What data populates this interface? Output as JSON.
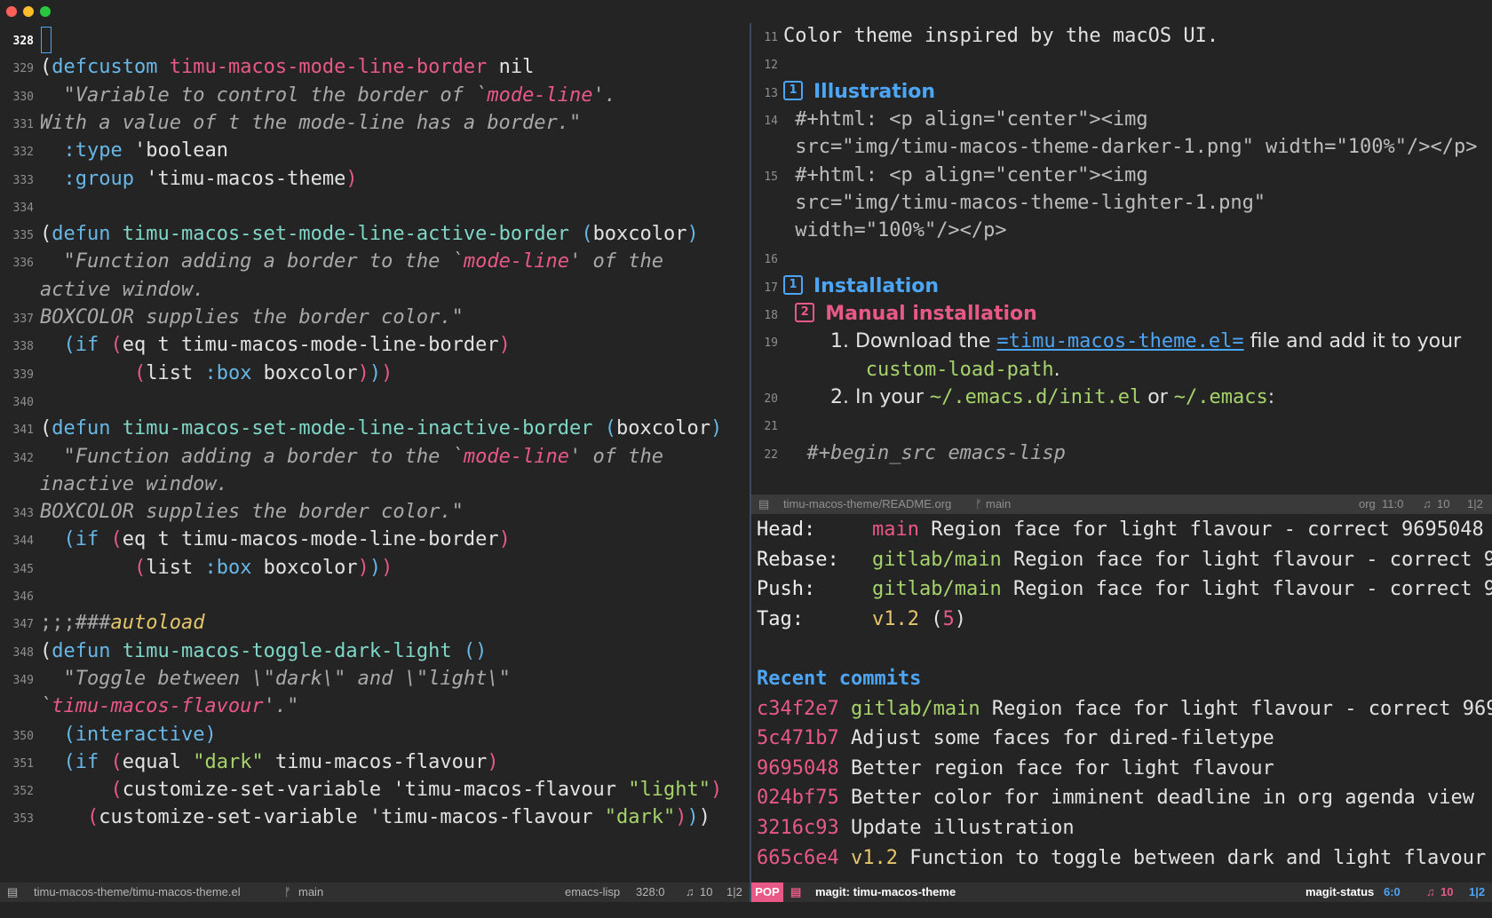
{
  "left_editor": {
    "lines": [
      {
        "num": "328",
        "current": true,
        "html": ""
      },
      {
        "num": "329",
        "html": "<span class=\"par1\">(</span><span class=\"kw\">defcustom</span> <span class=\"fn\">timu-macos-mode-line-border</span> nil"
      },
      {
        "num": "330",
        "html": "  <span class=\"str\">\"Variable to control the border of `</span><span class=\"strref\">mode-line</span><span class=\"str\">'.</span>"
      },
      {
        "num": "331",
        "html": "<span class=\"str\">With a value of t the mode-line has a border.\"</span>"
      },
      {
        "num": "332",
        "html": "  <span class=\"sym\">:type</span> 'boolean"
      },
      {
        "num": "333",
        "html": "  <span class=\"sym\">:group</span> 'timu-macos-theme<span class=\"par3\">)</span>"
      },
      {
        "num": "334",
        "html": ""
      },
      {
        "num": "335",
        "html": "<span class=\"par1\">(</span><span class=\"kw\">defun</span> <span class=\"fn2\">timu-macos-set-mode-line-active-border</span> <span class=\"par2\">(</span>boxcolor<span class=\"par2\">)</span>"
      },
      {
        "num": "336",
        "html": "  <span class=\"str\">\"Function adding a border to the `</span><span class=\"strref\">mode-line</span><span class=\"str\">' of the</span>"
      },
      {
        "num": null,
        "html": "<span class=\"str\">active window.</span>"
      },
      {
        "num": "337",
        "html": "<span class=\"str\">BOXCOLOR supplies the border color.\"</span>"
      },
      {
        "num": "338",
        "html": "  <span class=\"par2\">(</span><span class=\"kw\">if</span> <span class=\"par3\">(</span>eq t timu-macos-mode-line-border<span class=\"par3\">)</span>"
      },
      {
        "num": "339",
        "html": "        <span class=\"par3\">(</span>list <span class=\"sym\">:box</span> boxcolor<span class=\"par3\">)</span><span class=\"par2\">)</span><span class=\"par3\">)</span>"
      },
      {
        "num": "340",
        "html": ""
      },
      {
        "num": "341",
        "html": "<span class=\"par1\">(</span><span class=\"kw\">defun</span> <span class=\"fn2\">timu-macos-set-mode-line-inactive-border</span> <span class=\"par2\">(</span>boxcolor<span class=\"par2\">)</span>"
      },
      {
        "num": "342",
        "html": "  <span class=\"str\">\"Function adding a border to the `</span><span class=\"strref\">mode-line</span><span class=\"str\">' of the</span>"
      },
      {
        "num": null,
        "html": "<span class=\"str\">inactive window.</span>"
      },
      {
        "num": "343",
        "html": "<span class=\"str\">BOXCOLOR supplies the border color.\"</span>"
      },
      {
        "num": "344",
        "html": "  <span class=\"par2\">(</span><span class=\"kw\">if</span> <span class=\"par3\">(</span>eq t timu-macos-mode-line-border<span class=\"par3\">)</span>"
      },
      {
        "num": "345",
        "html": "        <span class=\"par3\">(</span>list <span class=\"sym\">:box</span> boxcolor<span class=\"par3\">)</span><span class=\"par2\">)</span><span class=\"par3\">)</span>"
      },
      {
        "num": "346",
        "html": ""
      },
      {
        "num": "347",
        "html": "<span class=\"comment\">;;;###</span><span class=\"autoload\">autoload</span>"
      },
      {
        "num": "348",
        "html": "<span class=\"par1\">(</span><span class=\"kw\">defun</span> <span class=\"fn2\">timu-macos-toggle-dark-light</span> <span class=\"par2\">()</span>"
      },
      {
        "num": "349",
        "html": "  <span class=\"str\">\"Toggle between \\\"dark\\\" and \\\"light\\\"</span>"
      },
      {
        "num": null,
        "html": "<span class=\"str\">`</span><span class=\"strref\">timu-macos-flavour</span><span class=\"str\">'.\"</span>"
      },
      {
        "num": "350",
        "html": "  <span class=\"par2\">(</span><span class=\"kw\">interactive</span><span class=\"par2\">)</span>"
      },
      {
        "num": "351",
        "html": "  <span class=\"par2\">(</span><span class=\"kw\">if</span> <span class=\"par3\">(</span>equal <span class=\"dstr\">\"dark\"</span> timu-macos-flavour<span class=\"par3\">)</span>"
      },
      {
        "num": "352",
        "html": "      <span class=\"par3\">(</span>customize-set-variable 'timu-macos-flavour <span class=\"dstr\">\"light\"</span><span class=\"par3\">)</span>"
      },
      {
        "num": "353",
        "html": "    <span class=\"par3\">(</span>customize-set-variable 'timu-macos-flavour <span class=\"dstr\">\"dark\"</span><span class=\"par3\">)</span><span class=\"par2\">)</span><span class=\"par1\">)</span>"
      }
    ]
  },
  "left_modeline": {
    "file": "timu-macos-theme/timu-macos-theme.el",
    "branch": "main",
    "mode": "emacs-lisp",
    "position": "328:0",
    "icon_count": "10",
    "window": "1|2"
  },
  "org_buffer": {
    "lines": [
      {
        "num": "11",
        "html": "Color theme inspired by the macOS UI."
      },
      {
        "num": "12",
        "html": ""
      },
      {
        "num": "13",
        "html": "<span class=\"heading1\"><span class=\"badge\" style=\"border-color:#4da5f5;color:#4da5f5\">1</span>Illustration</span>"
      },
      {
        "num": "14",
        "html": " <span class=\"orgmeta\">#+html: &lt;p align=\"center\"&gt;&lt;img</span>"
      },
      {
        "num": null,
        "html": " <span class=\"orgmeta\">src=\"img/timu-macos-theme-darker-1.png\" width=\"100%\"/&gt;&lt;/p&gt;</span>"
      },
      {
        "num": "15",
        "html": " <span class=\"orgmeta\">#+html: &lt;p align=\"center\"&gt;&lt;img</span>"
      },
      {
        "num": null,
        "html": " <span class=\"orgmeta\">src=\"img/timu-macos-theme-lighter-1.png\"</span>"
      },
      {
        "num": null,
        "html": " <span class=\"orgmeta\">width=\"100%\"/&gt;&lt;/p&gt;</span>"
      },
      {
        "num": "16",
        "html": ""
      },
      {
        "num": "17",
        "html": "<span class=\"heading1\"><span class=\"badge\" style=\"border-color:#4da5f5;color:#4da5f5\">1</span>Installation</span>"
      },
      {
        "num": "18",
        "html": " <span class=\"heading2\"><span class=\"badge\" style=\"border-color:#e95987;color:#e95987\">2</span>Manual installation</span>"
      },
      {
        "num": "19",
        "html": "    <span style=\"font-family:'DejaVu Sans',sans-serif\">1. Download the </span><span class=\"link\">=timu-macos-theme.el=</span><span style=\"font-family:'DejaVu Sans',sans-serif\"> file and add it to your</span>"
      },
      {
        "num": null,
        "html": "       <span class=\"green\">custom-load-path</span><span style=\"font-family:'DejaVu Sans',sans-serif\">.</span>"
      },
      {
        "num": "20",
        "html": "    <span style=\"font-family:'DejaVu Sans',sans-serif\">2. In your </span><span class=\"green\">~/.emacs.d/init.el</span><span style=\"font-family:'DejaVu Sans',sans-serif\"> or </span><span class=\"green\">~/.emacs</span><span style=\"font-family:'DejaVu Sans',sans-serif\">:</span>"
      },
      {
        "num": "21",
        "html": ""
      },
      {
        "num": "22",
        "html": "  <span class=\"str\">#+begin_src emacs-lisp</span>"
      }
    ]
  },
  "org_modeline": {
    "file": "timu-macos-theme/README.org",
    "branch": "main",
    "mode": "org",
    "position": "11:0",
    "icon_count": "10",
    "window": "1|2"
  },
  "magit": {
    "header": [
      {
        "label": "Head:",
        "ref": "main",
        "ref_class": "mg-branch",
        "msg": "Region face for light flavour - correct 9695048"
      },
      {
        "label": "Rebase:",
        "ref": "gitlab/main",
        "ref_class": "mg-remote",
        "msg": "Region face for light flavour - correct 9"
      },
      {
        "label": "Push:",
        "ref": "gitlab/main",
        "ref_class": "mg-remote",
        "msg": "Region face for light flavour - correct 9"
      }
    ],
    "tag_label": "Tag:",
    "tag_value": "v1.2",
    "tag_count": "5",
    "section_title": "Recent commits",
    "commits": [
      {
        "hash": "c34f2e7",
        "ref": "gitlab/main",
        "ref_class": "mg-remote",
        "msg": "Region face for light flavour - correct 969"
      },
      {
        "hash": "5c471b7",
        "ref": "",
        "ref_class": "",
        "msg": "Adjust some faces for dired-filetype"
      },
      {
        "hash": "9695048",
        "ref": "",
        "ref_class": "",
        "msg": "Better region face for light flavour"
      },
      {
        "hash": "024bf75",
        "ref": "",
        "ref_class": "",
        "msg": "Better color for imminent deadline in org agenda view"
      },
      {
        "hash": "3216c93",
        "ref": "",
        "ref_class": "",
        "msg": "Update illustration"
      },
      {
        "hash": "665c6e4",
        "ref": "v1.2",
        "ref_class": "mg-tag",
        "msg": "Function to toggle between dark and light flavour"
      }
    ]
  },
  "magit_modeline": {
    "pop": "POP",
    "buffer": "magit: timu-macos-theme",
    "mode": "magit-status",
    "position": "6:0",
    "icon_count": "10",
    "window": "1|2"
  },
  "colors": {
    "background": "#242424",
    "modeline": "#303030",
    "accent_blue": "#4da5f5",
    "accent_pink": "#e95987",
    "accent_green": "#a6d36b",
    "accent_yellow": "#e5c66b"
  }
}
